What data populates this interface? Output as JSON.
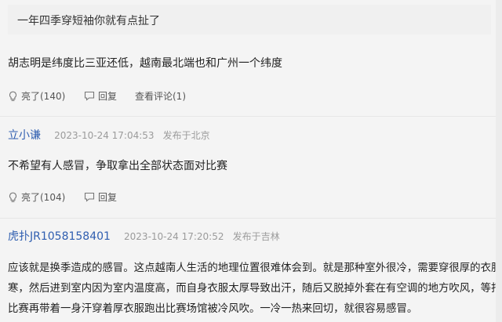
{
  "quote": {
    "text": "一年四季穿短袖你就有点扯了"
  },
  "comments": [
    {
      "text": "胡志明是纬度比三亚还低，越南最北端也和广州一个纬度",
      "likes": "亮了(140)",
      "reply": "回复",
      "view_replies": "查看评论(1)"
    },
    {
      "username": "立小谦",
      "time": "2023-10-24 17:04:53",
      "location": "发布于北京",
      "text": "不希望有人感冒，争取拿出全部状态面对比赛",
      "likes": "亮了(104)",
      "reply": "回复"
    },
    {
      "username": "虎扑JR1058158401",
      "time": "2023-10-24 17:20:52",
      "location": "发布于吉林",
      "lines": [
        "应该就是换季造成的感冒。这点越南人生活的地理位置很难体会到。就是那种室外很冷，需要穿很厚的衣服御",
        "寒，然后进到室内因为室内温度高，而自身衣服太厚导致出汗，随后又脱掉外套在有空调的地方吹风，等打完",
        "比赛再带着一身汗穿着厚衣服跑出比赛场馆被冷风吹。一冷一热来回切，就很容易感冒。"
      ]
    }
  ],
  "colors": {
    "username": "#2f5eb0",
    "meta": "#9b9b9b",
    "text": "#222222"
  }
}
